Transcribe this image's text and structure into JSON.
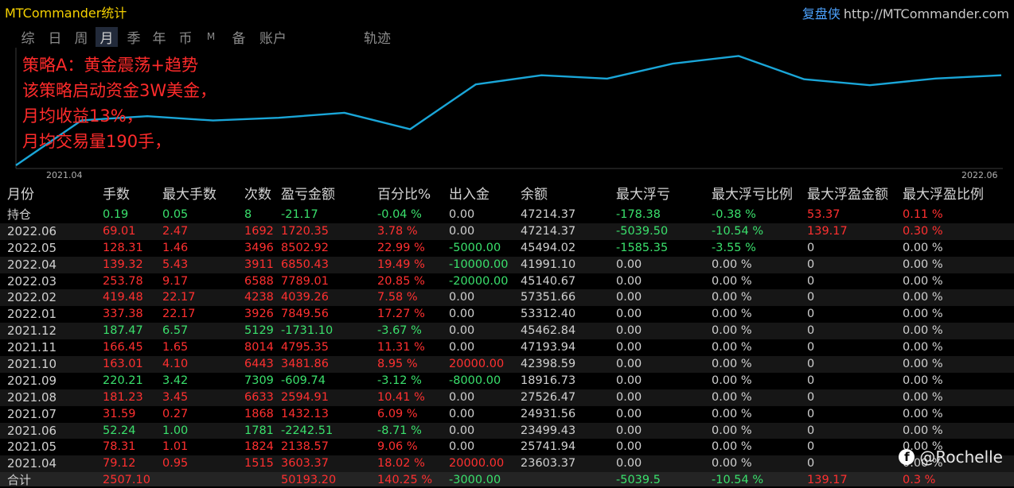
{
  "app_title": "MTCommander统计",
  "brand": {
    "name": "复盘侠",
    "url": "http://MTCommander.com"
  },
  "tabs": [
    {
      "label": "综",
      "active": false
    },
    {
      "label": "日",
      "active": false
    },
    {
      "label": "周",
      "active": false
    },
    {
      "label": "月",
      "active": true
    },
    {
      "label": "季",
      "active": false
    },
    {
      "label": "年",
      "active": false
    },
    {
      "label": "币",
      "active": false
    },
    {
      "label": "M",
      "active": false
    },
    {
      "label": "备",
      "active": false
    },
    {
      "label": "账户",
      "active": false
    },
    {
      "label": "轨迹",
      "active": false
    }
  ],
  "overlay_lines": [
    "策略A：黄金震荡+趋势",
    "该策略启动资金3W美金，",
    "月均收益13%，",
    "月均交易量190手，"
  ],
  "chart_data": {
    "type": "line",
    "x_start_label": "2021.04",
    "x_end_label": "2022.06",
    "line_color": "#1aa6d8",
    "x": [
      "2021.03",
      "2021.04",
      "2021.05",
      "2021.06",
      "2021.07",
      "2021.08",
      "2021.09",
      "2021.10",
      "2021.11",
      "2021.12",
      "2022.01",
      "2022.02",
      "2022.03",
      "2022.04",
      "2022.05",
      "2022.06"
    ],
    "values": [
      0,
      23603.37,
      25741.94,
      23499.43,
      24931.56,
      27526.47,
      18916.73,
      42398.59,
      47193.94,
      45462.84,
      53312.4,
      57351.66,
      45140.67,
      41991.1,
      45494.02,
      47214.37
    ]
  },
  "columns": [
    "月份",
    "手数",
    "最大手数",
    "次数",
    "盈亏金额",
    "百分比%",
    "出入金",
    "余额",
    "最大浮亏",
    "最大浮亏比例",
    "最大浮盈金额",
    "最大浮盈比例"
  ],
  "rows": [
    {
      "month": "持仓",
      "lots": "0.19",
      "max_lots": "0.05",
      "count": "8",
      "pnl": "-21.17",
      "pct": "-0.04 %",
      "flow": "0.00",
      "balance": "47214.37",
      "max_float_loss": "-178.38",
      "max_float_loss_pct": "-0.38 %",
      "max_float_profit": "53.37",
      "max_float_profit_pct": "0.11 %",
      "c": [
        "neg",
        "neg",
        "neg",
        "neg",
        "neg",
        "gray",
        "gray",
        "neg",
        "neg",
        "pos",
        "pos"
      ]
    },
    {
      "month": "2022.06",
      "lots": "69.01",
      "max_lots": "2.47",
      "count": "1692",
      "pnl": "1720.35",
      "pct": "3.78 %",
      "flow": "0.00",
      "balance": "47214.37",
      "max_float_loss": "-5039.50",
      "max_float_loss_pct": "-10.54 %",
      "max_float_profit": "139.17",
      "max_float_profit_pct": "0.30 %",
      "c": [
        "pos",
        "pos",
        "pos",
        "pos",
        "pos",
        "gray",
        "gray",
        "neg",
        "neg",
        "pos",
        "pos"
      ]
    },
    {
      "month": "2022.05",
      "lots": "128.31",
      "max_lots": "1.46",
      "count": "3496",
      "pnl": "8502.92",
      "pct": "22.99 %",
      "flow": "-5000.00",
      "balance": "45494.02",
      "max_float_loss": "-1585.35",
      "max_float_loss_pct": "-3.55 %",
      "max_float_profit": "0",
      "max_float_profit_pct": "0.00 %",
      "c": [
        "pos",
        "pos",
        "pos",
        "pos",
        "pos",
        "neg",
        "gray",
        "neg",
        "neg",
        "gray",
        "gray"
      ]
    },
    {
      "month": "2022.04",
      "lots": "139.32",
      "max_lots": "5.43",
      "count": "3911",
      "pnl": "6850.43",
      "pct": "19.49 %",
      "flow": "-10000.00",
      "balance": "41991.10",
      "max_float_loss": "0.00",
      "max_float_loss_pct": "0.00 %",
      "max_float_profit": "0",
      "max_float_profit_pct": "0.00 %",
      "c": [
        "pos",
        "pos",
        "pos",
        "pos",
        "pos",
        "neg",
        "gray",
        "gray",
        "gray",
        "gray",
        "gray"
      ]
    },
    {
      "month": "2022.03",
      "lots": "253.78",
      "max_lots": "9.17",
      "count": "6588",
      "pnl": "7789.01",
      "pct": "20.85 %",
      "flow": "-20000.00",
      "balance": "45140.67",
      "max_float_loss": "0.00",
      "max_float_loss_pct": "0.00 %",
      "max_float_profit": "0",
      "max_float_profit_pct": "0.00 %",
      "c": [
        "pos",
        "pos",
        "pos",
        "pos",
        "pos",
        "neg",
        "gray",
        "gray",
        "gray",
        "gray",
        "gray"
      ]
    },
    {
      "month": "2022.02",
      "lots": "419.48",
      "max_lots": "22.17",
      "count": "4238",
      "pnl": "4039.26",
      "pct": "7.58 %",
      "flow": "0.00",
      "balance": "57351.66",
      "max_float_loss": "0.00",
      "max_float_loss_pct": "0.00 %",
      "max_float_profit": "0",
      "max_float_profit_pct": "0.00 %",
      "c": [
        "pos",
        "pos",
        "pos",
        "pos",
        "pos",
        "gray",
        "gray",
        "gray",
        "gray",
        "gray",
        "gray"
      ]
    },
    {
      "month": "2022.01",
      "lots": "337.38",
      "max_lots": "22.17",
      "count": "3926",
      "pnl": "7849.56",
      "pct": "17.27 %",
      "flow": "0.00",
      "balance": "53312.40",
      "max_float_loss": "0.00",
      "max_float_loss_pct": "0.00 %",
      "max_float_profit": "0",
      "max_float_profit_pct": "0.00 %",
      "c": [
        "pos",
        "pos",
        "pos",
        "pos",
        "pos",
        "gray",
        "gray",
        "gray",
        "gray",
        "gray",
        "gray"
      ]
    },
    {
      "month": "2021.12",
      "lots": "187.47",
      "max_lots": "6.57",
      "count": "5129",
      "pnl": "-1731.10",
      "pct": "-3.67 %",
      "flow": "0.00",
      "balance": "45462.84",
      "max_float_loss": "0.00",
      "max_float_loss_pct": "0.00 %",
      "max_float_profit": "0",
      "max_float_profit_pct": "0.00 %",
      "c": [
        "neg",
        "neg",
        "neg",
        "neg",
        "neg",
        "gray",
        "gray",
        "gray",
        "gray",
        "gray",
        "gray"
      ]
    },
    {
      "month": "2021.11",
      "lots": "166.45",
      "max_lots": "1.65",
      "count": "8014",
      "pnl": "4795.35",
      "pct": "11.31 %",
      "flow": "0.00",
      "balance": "47193.94",
      "max_float_loss": "0.00",
      "max_float_loss_pct": "0.00 %",
      "max_float_profit": "0",
      "max_float_profit_pct": "0.00 %",
      "c": [
        "pos",
        "pos",
        "pos",
        "pos",
        "pos",
        "gray",
        "gray",
        "gray",
        "gray",
        "gray",
        "gray"
      ]
    },
    {
      "month": "2021.10",
      "lots": "163.01",
      "max_lots": "4.10",
      "count": "6443",
      "pnl": "3481.86",
      "pct": "8.95 %",
      "flow": "20000.00",
      "balance": "42398.59",
      "max_float_loss": "0.00",
      "max_float_loss_pct": "0.00 %",
      "max_float_profit": "0",
      "max_float_profit_pct": "0.00 %",
      "c": [
        "pos",
        "pos",
        "pos",
        "pos",
        "pos",
        "pos",
        "gray",
        "gray",
        "gray",
        "gray",
        "gray"
      ]
    },
    {
      "month": "2021.09",
      "lots": "220.21",
      "max_lots": "3.42",
      "count": "7309",
      "pnl": "-609.74",
      "pct": "-3.12 %",
      "flow": "-8000.00",
      "balance": "18916.73",
      "max_float_loss": "0.00",
      "max_float_loss_pct": "0.00 %",
      "max_float_profit": "0",
      "max_float_profit_pct": "0.00 %",
      "c": [
        "neg",
        "neg",
        "neg",
        "neg",
        "neg",
        "neg",
        "gray",
        "gray",
        "gray",
        "gray",
        "gray"
      ]
    },
    {
      "month": "2021.08",
      "lots": "181.23",
      "max_lots": "3.45",
      "count": "6633",
      "pnl": "2594.91",
      "pct": "10.41 %",
      "flow": "0.00",
      "balance": "27526.47",
      "max_float_loss": "0.00",
      "max_float_loss_pct": "0.00 %",
      "max_float_profit": "0",
      "max_float_profit_pct": "0.00 %",
      "c": [
        "pos",
        "pos",
        "pos",
        "pos",
        "pos",
        "gray",
        "gray",
        "gray",
        "gray",
        "gray",
        "gray"
      ]
    },
    {
      "month": "2021.07",
      "lots": "31.59",
      "max_lots": "0.27",
      "count": "1868",
      "pnl": "1432.13",
      "pct": "6.09 %",
      "flow": "0.00",
      "balance": "24931.56",
      "max_float_loss": "0.00",
      "max_float_loss_pct": "0.00 %",
      "max_float_profit": "0",
      "max_float_profit_pct": "0.00 %",
      "c": [
        "pos",
        "pos",
        "pos",
        "pos",
        "pos",
        "gray",
        "gray",
        "gray",
        "gray",
        "gray",
        "gray"
      ]
    },
    {
      "month": "2021.06",
      "lots": "52.24",
      "max_lots": "1.00",
      "count": "1781",
      "pnl": "-2242.51",
      "pct": "-8.71 %",
      "flow": "0.00",
      "balance": "23499.43",
      "max_float_loss": "0.00",
      "max_float_loss_pct": "0.00 %",
      "max_float_profit": "0",
      "max_float_profit_pct": "0.00 %",
      "c": [
        "neg",
        "neg",
        "neg",
        "neg",
        "neg",
        "gray",
        "gray",
        "gray",
        "gray",
        "gray",
        "gray"
      ]
    },
    {
      "month": "2021.05",
      "lots": "78.31",
      "max_lots": "1.01",
      "count": "1824",
      "pnl": "2138.57",
      "pct": "9.06 %",
      "flow": "0.00",
      "balance": "25741.94",
      "max_float_loss": "0.00",
      "max_float_loss_pct": "0.00 %",
      "max_float_profit": "0",
      "max_float_profit_pct": "0.00 %",
      "c": [
        "pos",
        "pos",
        "pos",
        "pos",
        "pos",
        "gray",
        "gray",
        "gray",
        "gray",
        "gray",
        "gray"
      ]
    },
    {
      "month": "2021.04",
      "lots": "79.12",
      "max_lots": "0.95",
      "count": "1515",
      "pnl": "3603.37",
      "pct": "18.02 %",
      "flow": "20000.00",
      "balance": "23603.37",
      "max_float_loss": "0.00",
      "max_float_loss_pct": "0.00 %",
      "max_float_profit": "0",
      "max_float_profit_pct": "0.00 %",
      "c": [
        "pos",
        "pos",
        "pos",
        "pos",
        "pos",
        "pos",
        "gray",
        "gray",
        "gray",
        "gray",
        "gray"
      ]
    }
  ],
  "total": {
    "month": "合计",
    "lots": "2507.10",
    "max_lots": "",
    "count": "",
    "pnl": "50193.20",
    "pct": "140.25 %",
    "flow": "-3000.00",
    "balance": "",
    "max_float_loss": "-5039.5",
    "max_float_loss_pct": "-10.54 %",
    "max_float_profit": "139.17",
    "max_float_profit_pct": "0.3 %",
    "c": [
      "pos",
      "pos",
      "pos",
      "pos",
      "pos",
      "neg",
      "gray",
      "neg",
      "neg",
      "pos",
      "pos"
    ]
  },
  "watermark": {
    "icon": "facebook-icon",
    "text": "@Rochelle"
  }
}
